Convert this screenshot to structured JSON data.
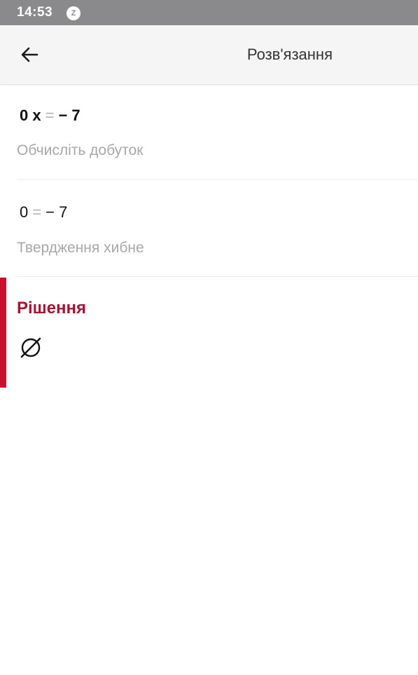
{
  "status_bar": {
    "time": "14:53",
    "notification_icon": "z-badge-icon",
    "notification_glyph": "Z"
  },
  "header": {
    "title": "Розв'язання",
    "back_icon": "arrow-left-icon"
  },
  "steps": [
    {
      "expression": {
        "left": "0 x",
        "equals": "=",
        "right": "− 7"
      },
      "explanation": "Обчисліть добуток"
    },
    {
      "expression": {
        "left": "0",
        "equals": "=",
        "right": "− 7"
      },
      "explanation": "Твердження хибне"
    }
  ],
  "solution": {
    "title": "Рішення",
    "answer_icon": "empty-set-icon"
  },
  "colors": {
    "status_bar": "#8a8a8c",
    "app_bar": "#f5f5f5",
    "accent": "#c8102e",
    "solution_title": "#a51535",
    "muted_text": "#a8a8a8"
  }
}
